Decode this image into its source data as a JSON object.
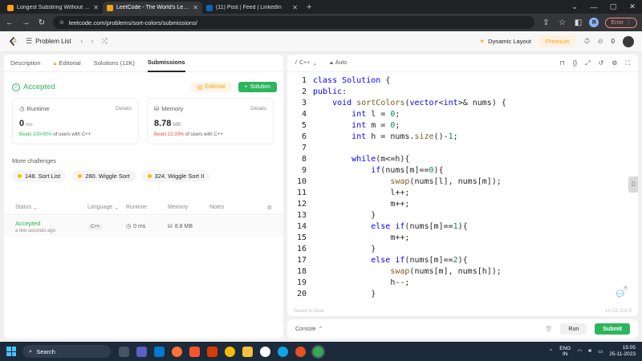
{
  "browser": {
    "tabs": [
      {
        "title": "Longest Substring Without Repe",
        "color": "#ffa116",
        "active": false
      },
      {
        "title": "LeetCode - The World's Leading",
        "color": "#ffa116",
        "active": true
      },
      {
        "title": "(11) Post | Feed | LinkedIn",
        "color": "#0a66c2",
        "active": false
      }
    ],
    "url": "leetcode.com/problems/sort-colors/submissions/",
    "profile_letter": "R",
    "error_label": "Error"
  },
  "header": {
    "problem_list": "Problem List",
    "dynamic_layout": "Dynamic Layout",
    "premium": "Premium",
    "fire_count": "0"
  },
  "left": {
    "tabs": [
      "Description",
      "Editorial",
      "Solutions (12K)",
      "Submissions"
    ],
    "accepted": "Accepted",
    "editorial_btn": "Editorial",
    "solution_btn": "Solution",
    "runtime": {
      "label": "Runtime",
      "details": "Details",
      "value": "0",
      "unit": "ms",
      "beats_pct": "Beats 100.00%",
      "beats_rest": "of users with C++"
    },
    "memory": {
      "label": "Memory",
      "details": "Details",
      "value": "8.78",
      "unit": "MB",
      "beats_pct": "Beats 15.33%",
      "beats_rest": "of users with C++"
    },
    "more_challenges": "More challenges",
    "challenges": [
      "148. Sort List",
      "280. Wiggle Sort",
      "324. Wiggle Sort II"
    ],
    "table": {
      "headers": [
        "Status",
        "Language",
        "Runtime",
        "Memory",
        "Notes"
      ],
      "row": {
        "status": "Accepted",
        "time": "a few seconds ago",
        "language": "C++",
        "runtime": "0 ms",
        "memory": "8.8 MB"
      }
    }
  },
  "editor": {
    "language": "C++",
    "mode": "Auto",
    "saved": "Saved to local",
    "cursor": "Ln 22, Col 3",
    "lines": [
      "class Solution {",
      "public:",
      "    void sortColors(vector<int>& nums) {",
      "        int l = 0;",
      "        int m = 0;",
      "        int h = nums.size()-1;",
      "",
      "        while(m<=h){",
      "            if(nums[m]==0){",
      "                swap(nums[l], nums[m]);",
      "                l++;",
      "                m++;",
      "            }",
      "            else if(nums[m]==1){",
      "                m++;",
      "            }",
      "            else if(nums[m]==2){",
      "                swap(nums[m], nums[h]);",
      "                h--;",
      "            }"
    ]
  },
  "console": {
    "label": "Console",
    "run": "Run",
    "submit": "Submit"
  },
  "taskbar": {
    "search": "Search",
    "lang1": "ENG",
    "lang2": "IN",
    "time": "15:05",
    "date": "25-11-2023"
  }
}
